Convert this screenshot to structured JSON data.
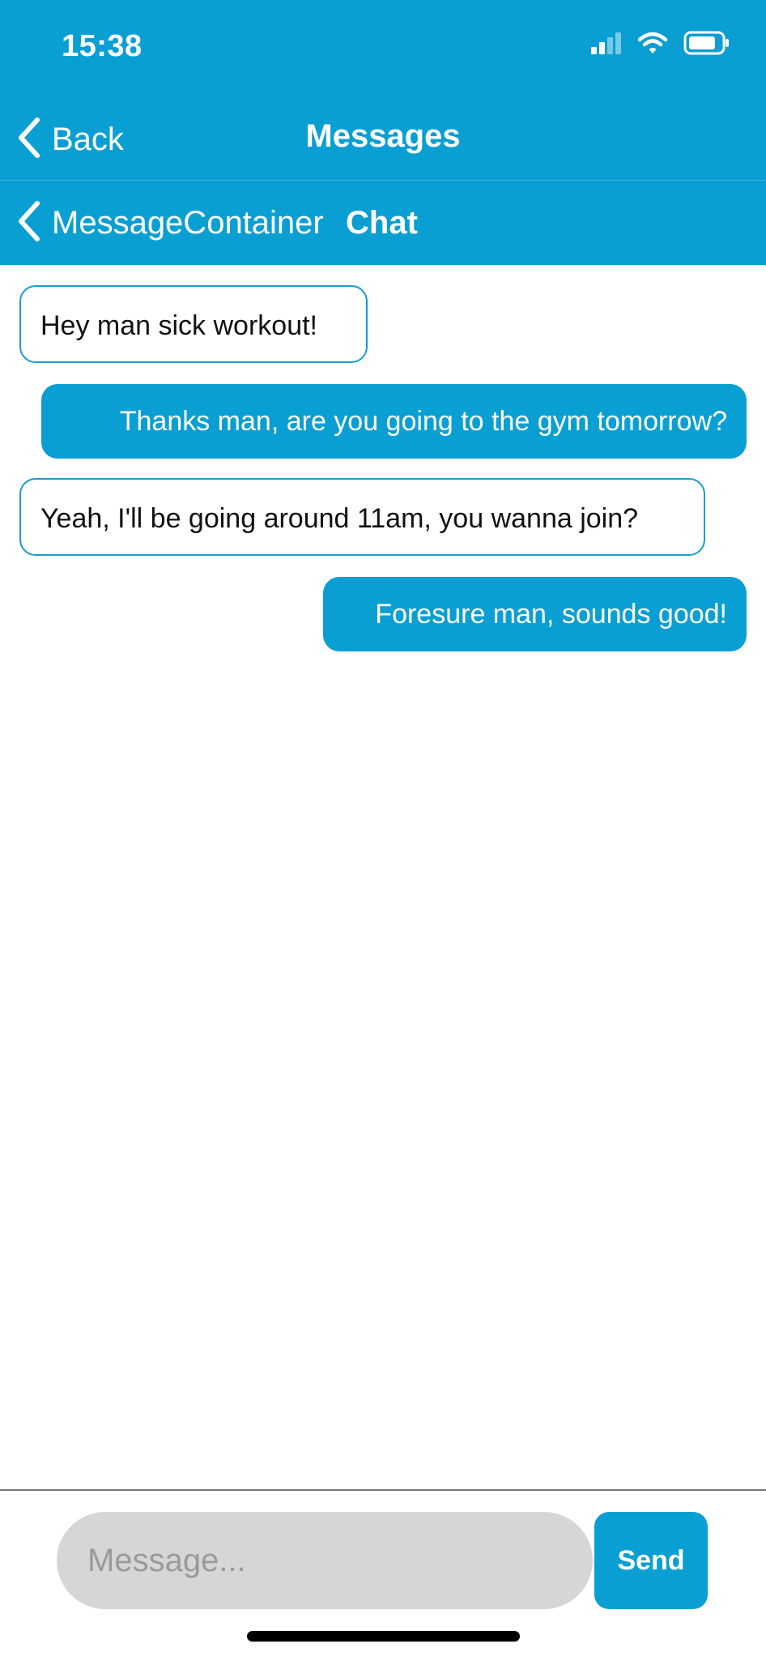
{
  "status_bar": {
    "time": "15:38",
    "icons": [
      "signal-icon",
      "wifi-icon",
      "battery-icon"
    ]
  },
  "nav": {
    "back_label": "Back",
    "title": "Messages"
  },
  "sub_nav": {
    "back_label": "MessageContainer",
    "title": "Chat"
  },
  "messages": [
    {
      "direction": "received",
      "text": "Hey man sick workout!"
    },
    {
      "direction": "sent",
      "text": "Thanks man, are you going to the gym tomorrow?"
    },
    {
      "direction": "received",
      "text": "Yeah, I'll be going around 11am, you wanna join?"
    },
    {
      "direction": "sent",
      "text": "Foresure man, sounds good!"
    }
  ],
  "composer": {
    "placeholder": "Message...",
    "value": "",
    "send_label": "Send"
  },
  "colors": {
    "accent": "#0a9fd3",
    "input_background": "#d6d6d6"
  }
}
